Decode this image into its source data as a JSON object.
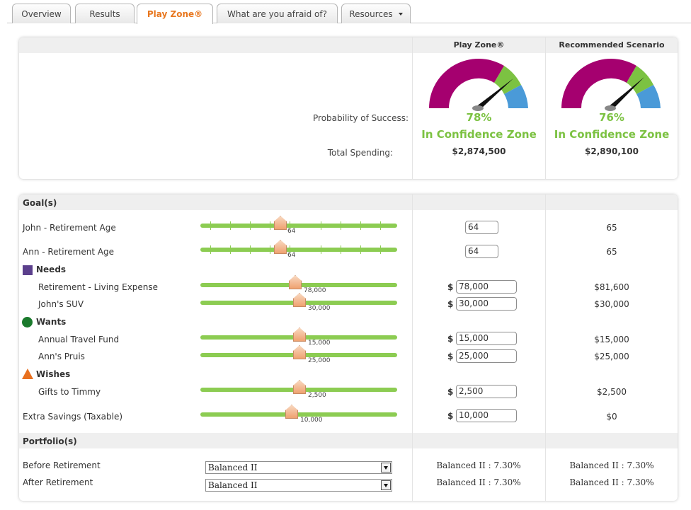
{
  "tabs": [
    {
      "label": "Overview"
    },
    {
      "label": "Results"
    },
    {
      "label": "Play Zone®"
    },
    {
      "label": "What are you afraid of?"
    },
    {
      "label": "Resources"
    }
  ],
  "summary": {
    "col_playzone": "Play Zone®",
    "col_recommended": "Recommended Scenario",
    "probability_label": "Probability of Success:",
    "spending_label": "Total Spending:",
    "playzone": {
      "percent": "78%",
      "zone": "In Confidence Zone",
      "spending": "$2,874,500"
    },
    "recommended": {
      "percent": "76%",
      "zone": "In Confidence Zone",
      "spending": "$2,890,100"
    }
  },
  "colors": {
    "magenta": "#a5006f",
    "green": "#7cc242",
    "blue": "#4a9ad8",
    "needs": "#5b3f8c",
    "wants": "#1a7a2c",
    "wishes": "#e8701f"
  },
  "goals": {
    "header": "Goal(s)",
    "john": {
      "label": "John - Retirement Age",
      "slider": "64",
      "input": "64",
      "rec": "65"
    },
    "ann": {
      "label": "Ann - Retirement Age",
      "slider": "64",
      "input": "64",
      "rec": "65"
    },
    "needs": {
      "label": "Needs",
      "icon": "square-icon"
    },
    "living": {
      "label": "Retirement - Living Expense",
      "slider": "78,000",
      "input": "78,000",
      "rec": "$81,600"
    },
    "suv": {
      "label": "John's SUV",
      "slider": "30,000",
      "input": "30,000",
      "rec": "$30,000"
    },
    "wants": {
      "label": "Wants",
      "icon": "circle-icon"
    },
    "travel": {
      "label": "Annual Travel Fund",
      "slider": "15,000",
      "input": "15,000",
      "rec": "$15,000"
    },
    "pruis": {
      "label": "Ann's Pruis",
      "slider": "25,000",
      "input": "25,000",
      "rec": "$25,000"
    },
    "wishes": {
      "label": "Wishes",
      "icon": "triangle-icon"
    },
    "gifts": {
      "label": "Gifts to Timmy",
      "slider": "2,500",
      "input": "2,500",
      "rec": "$2,500"
    },
    "savings": {
      "label": "Extra Savings (Taxable)",
      "slider": "10,000",
      "input": "10,000",
      "rec": "$0"
    },
    "dollar": "$"
  },
  "portfolio": {
    "header": "Portfolio(s)",
    "before": {
      "label": "Before Retirement",
      "select": "Balanced II",
      "pz": "Balanced II : 7.30%",
      "rec": "Balanced II : 7.30%"
    },
    "after": {
      "label": "After Retirement",
      "select": "Balanced II",
      "pz": "Balanced II : 7.30%",
      "rec": "Balanced II : 7.30%"
    }
  }
}
